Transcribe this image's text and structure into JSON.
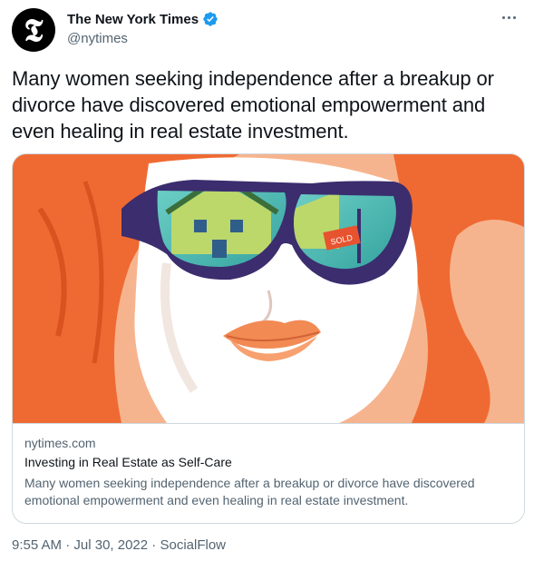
{
  "author": {
    "display_name": "The New York Times",
    "handle": "@nytimes",
    "avatar_glyph": "𝕿",
    "verified": true,
    "verified_color": "#1d9bf0"
  },
  "tweet": {
    "text": "Many women seeking independence after a breakup or divorce have discovered emotional empowerment and even healing in real estate investment."
  },
  "card": {
    "image_icon": "illustration-woman-sunglasses-house",
    "domain": "nytimes.com",
    "title": "Investing in Real Estate as Self-Care",
    "description": "Many women seeking independence after a breakup or divorce have discovered emotional empowerment and even healing in real estate investment.",
    "sign_text": "SOLD"
  },
  "meta": {
    "time": "9:55 AM",
    "separator": " · ",
    "date": "Jul 30, 2022",
    "source": "SocialFlow"
  },
  "colors": {
    "text": "#0f1419",
    "secondary": "#536471",
    "border": "#cfd9de",
    "illustration_bg": "#f6b48e",
    "hair": "#ef6a32"
  }
}
